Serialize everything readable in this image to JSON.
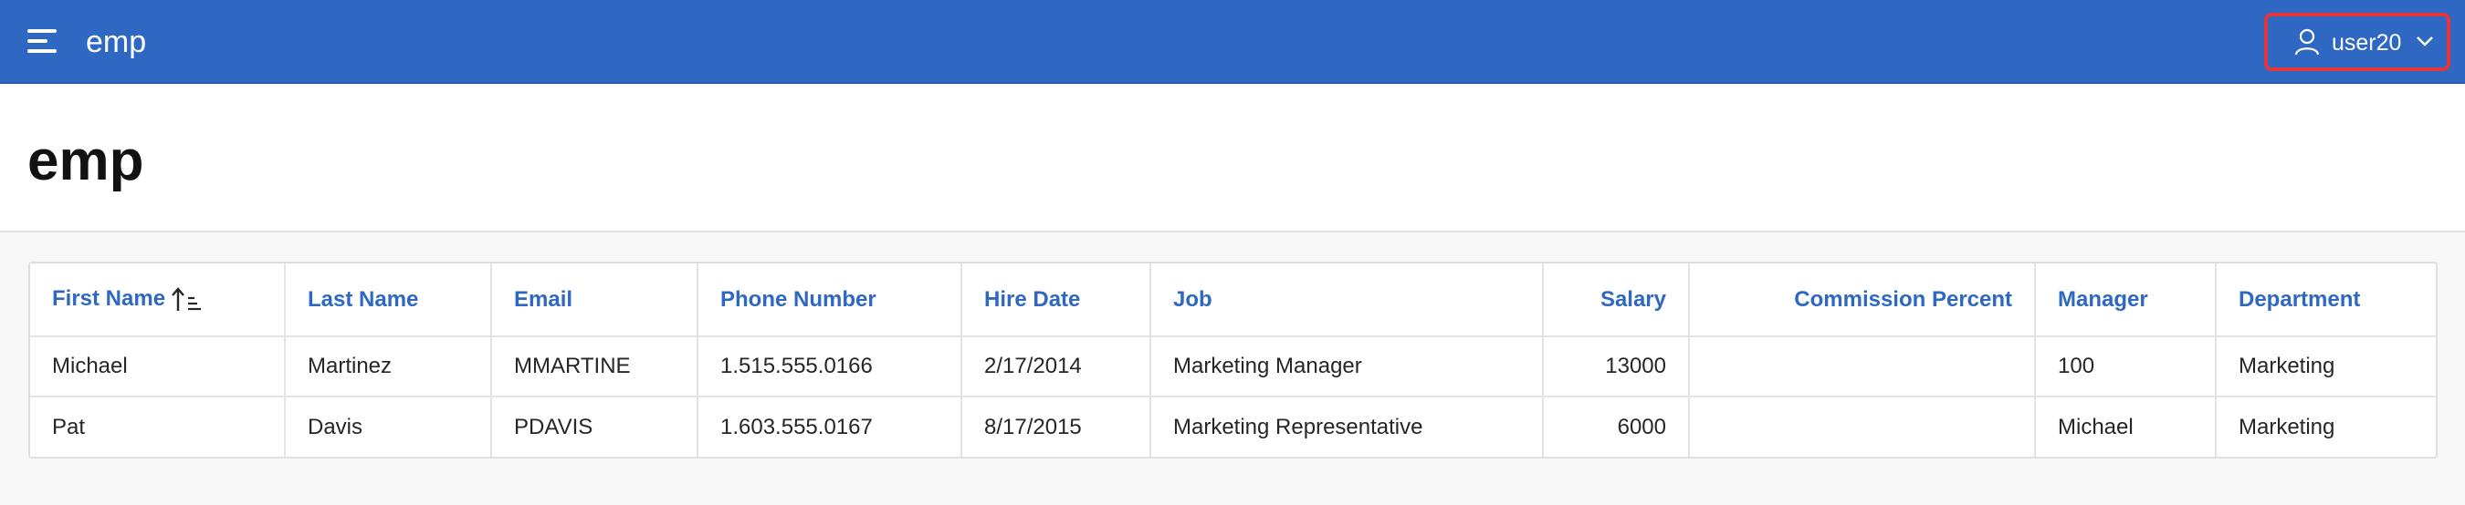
{
  "app": {
    "title": "emp",
    "user": "user20",
    "colors": {
      "header": "#2f68c3",
      "link": "#2f68c3",
      "highlight": "#e5343a"
    }
  },
  "page": {
    "title": "emp"
  },
  "icons": {
    "menu": "hamburger-menu-icon",
    "user": "user-icon",
    "dropdown": "chevron-down-icon",
    "sort": "sort-ascending-icon"
  },
  "table": {
    "sorted_column": "First Name",
    "sort_direction": "ascending",
    "columns": [
      "First Name",
      "Last Name",
      "Email",
      "Phone Number",
      "Hire Date",
      "Job",
      "Salary",
      "Commission Percent",
      "Manager",
      "Department"
    ],
    "rows": [
      [
        "Michael",
        "Martinez",
        "MMARTINE",
        "1.515.555.0166",
        "2/17/2014",
        "Marketing Manager",
        "13000",
        "",
        "100",
        "Marketing"
      ],
      [
        "Pat",
        "Davis",
        "PDAVIS",
        "1.603.555.0167",
        "8/17/2015",
        "Marketing Representative",
        "6000",
        "",
        "Michael",
        "Marketing"
      ]
    ]
  }
}
